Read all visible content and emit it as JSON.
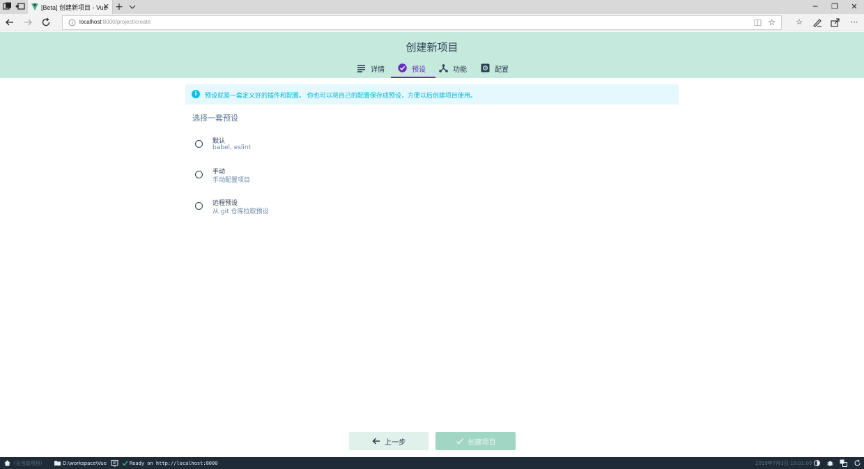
{
  "browser": {
    "tab_title": "[Beta] 创建新项目 - Vue",
    "url_host": "localhost",
    "url_rest": ":8000/project/create",
    "new_tab_symbol": "+",
    "close_symbol": "✕",
    "minimize_symbol": "─",
    "restore_symbol": "❐",
    "more_symbol": "⋯"
  },
  "header": {
    "title": "创建新项目",
    "steps": [
      {
        "label": "详情",
        "icon": "list-icon",
        "active": false
      },
      {
        "label": "预设",
        "icon": "check-circle-icon",
        "active": true
      },
      {
        "label": "功能",
        "icon": "fork-icon",
        "active": false
      },
      {
        "label": "配置",
        "icon": "settings-box-icon",
        "active": false
      }
    ]
  },
  "info": {
    "icon_glyph": "i",
    "text": "预设就是一套定义好的插件和配置。 你也可以将自己的配置保存成预设，方便以后创建项目使用。"
  },
  "presets": {
    "section_title": "选择一套预设",
    "items": [
      {
        "name": "默认",
        "description": "babel, eslint"
      },
      {
        "name": "手动",
        "description": "手动配置项目"
      },
      {
        "name": "远程预设",
        "description": "从 git 仓库拉取预设"
      }
    ]
  },
  "actions": {
    "prev_label": "上一步",
    "create_label": "创建项目"
  },
  "statusbar": {
    "project": "(无当前项目)",
    "path": "D:\\workspace\\Vue",
    "log": "Ready on http://localhost:8000",
    "datetime": "2019年7月3日 10:01:09"
  },
  "colors": {
    "header_bg": "#c6e9dd",
    "accent_purple": "#6a2ebc",
    "info_bg": "#e4f8fd",
    "info_text": "#03b5d6",
    "button_primary_disabled": "#a2d6c4",
    "statusbar_bg": "#1f2c38"
  }
}
